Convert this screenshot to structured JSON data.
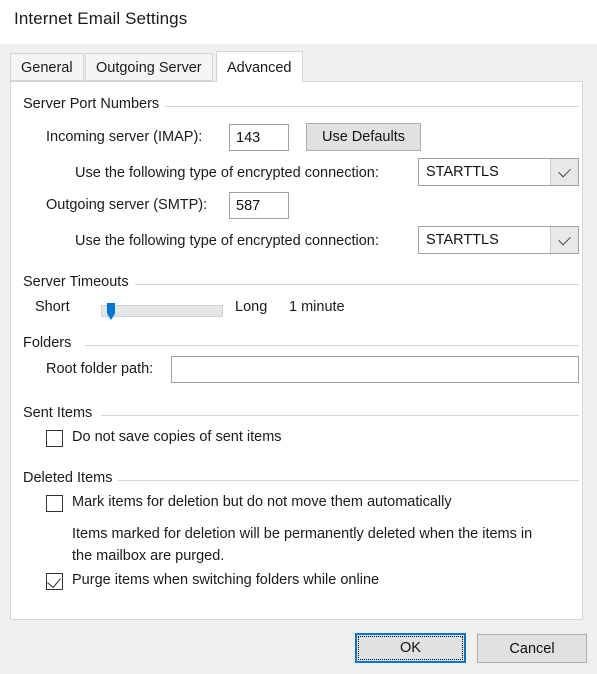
{
  "window": {
    "title": "Internet Email Settings"
  },
  "tabs": [
    {
      "label": "General",
      "selected": false
    },
    {
      "label": "Outgoing Server",
      "selected": false
    },
    {
      "label": "Advanced",
      "selected": true
    }
  ],
  "groups": {
    "server_ports": {
      "label": "Server Port Numbers",
      "incoming_label": "Incoming server (IMAP):",
      "incoming_value": "143",
      "use_defaults_label": "Use Defaults",
      "incoming_encryption_label": "Use the following type of encrypted connection:",
      "incoming_encryption_value": "STARTTLS",
      "outgoing_label": "Outgoing server (SMTP):",
      "outgoing_value": "587",
      "outgoing_encryption_label": "Use the following type of encrypted connection:",
      "outgoing_encryption_value": "STARTTLS"
    },
    "server_timeouts": {
      "label": "Server Timeouts",
      "short_label": "Short",
      "long_label": "Long",
      "value_text": "1 minute",
      "slider_percent": 6
    },
    "folders": {
      "label": "Folders",
      "root_folder_label": "Root folder path:",
      "root_folder_value": "",
      "root_folder_placeholder": ""
    },
    "sent_items": {
      "label": "Sent Items",
      "do_not_save_label": "Do not save copies of sent items",
      "do_not_save_checked": false
    },
    "deleted_items": {
      "label": "Deleted Items",
      "mark_items_label": "Mark items for deletion but do not move them automatically",
      "mark_items_checked": false,
      "help_line_1": "Items marked for deletion will be permanently deleted when the items in",
      "help_line_2": "the mailbox are purged.",
      "purge_items_label": "Purge items when switching folders while online",
      "purge_items_checked": true
    }
  },
  "footer": {
    "ok_label": "OK",
    "cancel_label": "Cancel"
  },
  "colors": {
    "accent": "#0078d7",
    "dialog_bg": "#f0f0f0",
    "panel_bg": "#ffffff",
    "button_bg": "#e1e1e1"
  }
}
